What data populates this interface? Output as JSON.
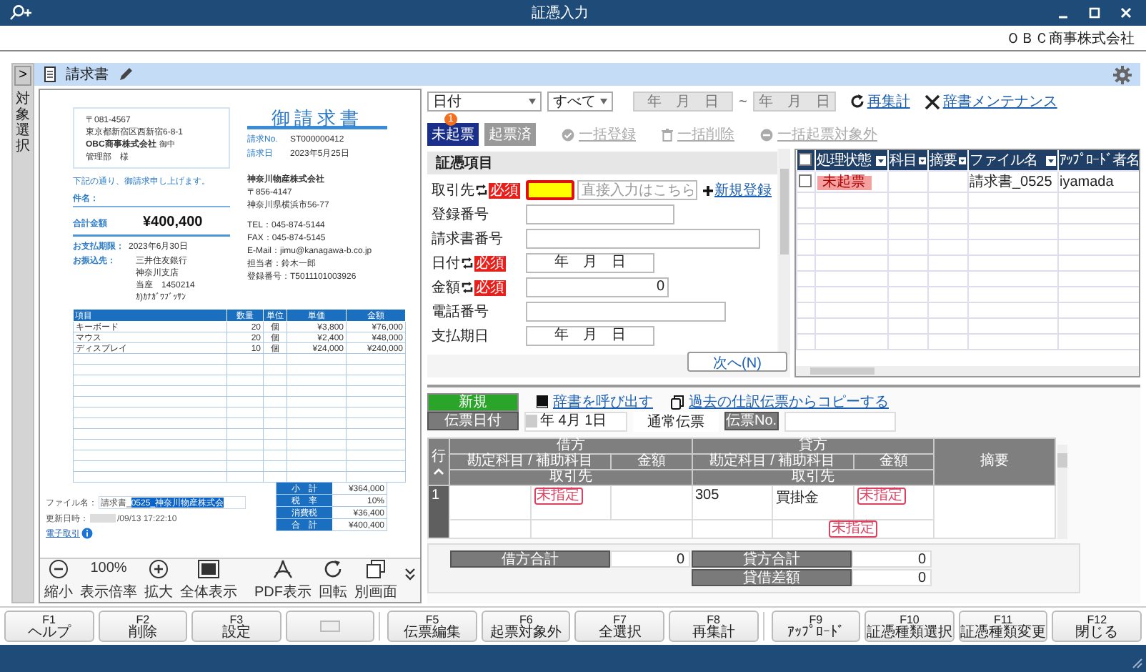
{
  "window": {
    "title": "証憑入力",
    "company": "ＯＢＣ商事株式会社"
  },
  "side_panel": {
    "expand_glyph": ">",
    "label": "対象選択"
  },
  "header": {
    "title": "請求書"
  },
  "preview": {
    "document": {
      "address": [
        "〒081-4567",
        "東京都新宿区西新宿6-8-1"
      ],
      "recipient": "OBC商事株式会社",
      "honorific": "御中",
      "department": "管理部　様",
      "title": "御請求書",
      "meta": [
        {
          "label": "請求No.",
          "value": "ST000000412"
        },
        {
          "label": "請求日",
          "value": "2023年5月25日"
        }
      ],
      "greeting": "下記の通り、御請求申し上げます。",
      "subject_label": "件名：",
      "total_label": "合計金額",
      "total": "¥400,400",
      "issuer": {
        "name": "神奈川物産株式会社",
        "lines": [
          "〒856-4147",
          "神奈川県横浜市56-77"
        ],
        "contact": [
          "TEL：045-874-5144",
          "FAX：045-874-5145",
          "E-Mail：jimu@kanagawa-b.co.jp",
          "担当者：鈴木一郎",
          "登録番号：T5011101003926"
        ]
      },
      "payment": [
        {
          "label": "お支払期限：",
          "lines": [
            "2023年6月30日"
          ]
        },
        {
          "label": "お振込先：",
          "lines": [
            "三井住友銀行",
            "神奈川支店",
            "当座　1450214",
            "ｶ)ｶﾅｶﾞﾜﾌﾞｯｻﾝ"
          ]
        }
      ],
      "table": {
        "columns": [
          "項目",
          "数量",
          "単位",
          "単価",
          "金額"
        ],
        "rows": [
          [
            "キーボード",
            "20",
            "個",
            "¥3,800",
            "¥76,000"
          ],
          [
            "マウス",
            "20",
            "個",
            "¥2,400",
            "¥48,000"
          ],
          [
            "ディスプレイ",
            "10",
            "個",
            "¥24,000",
            "¥240,000"
          ]
        ]
      },
      "totals": [
        {
          "label": "小　計",
          "value": "¥364,000"
        },
        {
          "label": "税　率",
          "value": "10%"
        },
        {
          "label": "消費税",
          "value": "¥36,400"
        },
        {
          "label": "合　計",
          "value": "¥400,400"
        }
      ]
    },
    "file_info": {
      "file_label": "ファイル名：",
      "file_value": "請求書_",
      "file_selected": "0525_神奈川物産株式会",
      "updated_label": "更新日時：",
      "updated_value": "/09/13 17:22:10",
      "link": "電子取引"
    },
    "toolbar": [
      {
        "kind": "zoom_out",
        "label": "縮小"
      },
      {
        "kind": "zoom_level",
        "value": "100%",
        "label": "表示倍率"
      },
      {
        "kind": "zoom_in",
        "label": "拡大"
      },
      {
        "kind": "fit",
        "label": "全体表示"
      },
      {
        "kind": "pdf",
        "label": "PDF表示"
      },
      {
        "kind": "rotate",
        "label": "回転"
      },
      {
        "kind": "window",
        "label": "別画面"
      }
    ]
  },
  "filters": {
    "date_type": "日付",
    "status": "すべて",
    "date_from": "年　月　日",
    "range_sep": "~",
    "date_to": "年　月　日",
    "links": [
      {
        "kind": "refresh",
        "label": "再集計"
      },
      {
        "kind": "tools",
        "label": "辞書メンテナンス"
      }
    ]
  },
  "status_tabs": [
    {
      "label": "未起票",
      "selected": true,
      "badge": "1"
    },
    {
      "label": "起票済",
      "selected": false
    }
  ],
  "bulk_actions": [
    {
      "kind": "register",
      "label": "一括登録",
      "disabled": true
    },
    {
      "kind": "delete",
      "label": "一括削除",
      "disabled": true
    },
    {
      "kind": "exclude",
      "label": "一括起票対象外",
      "disabled": true
    }
  ],
  "form": {
    "section": "証憑項目",
    "fields": [
      {
        "kind": "partner",
        "label": "取引先",
        "sync": true,
        "badge": "必須",
        "focused": true,
        "placeholder": "直接入力はこちら",
        "link": "新規登録"
      },
      {
        "kind": "text_short",
        "label": "登録番号",
        "sync": false
      },
      {
        "kind": "text_long",
        "label": "請求書番号",
        "sync": false
      },
      {
        "kind": "date",
        "label": "日付",
        "sync": true,
        "badge": "必須",
        "value": "年　月　日"
      },
      {
        "kind": "number",
        "label": "金額",
        "sync": true,
        "badge": "必須",
        "value": "0"
      },
      {
        "kind": "text_medium",
        "label": "電話番号",
        "sync": false
      },
      {
        "kind": "date",
        "label": "支払期日",
        "sync": false,
        "value": "年　月　日"
      }
    ],
    "next_button": "次へ(N)"
  },
  "documents": {
    "all_checked": false,
    "columns": [
      "処理状態",
      "科目",
      "摘要",
      "ファイル名",
      "ｱｯﾌﾟﾛｰﾄﾞ者名"
    ],
    "rows": [
      {
        "checked": false,
        "status": "未起票",
        "file": "請求書_0525",
        "uploader": "iyamada"
      }
    ]
  },
  "journal": {
    "new_label": "新規",
    "links": [
      {
        "kind": "book",
        "label": "辞書を呼び出す"
      },
      {
        "kind": "copy",
        "label": "過去の仕訳伝票からコピーする"
      }
    ],
    "date_label": "伝票日付",
    "date_value": "年  4月  1日",
    "type": "通常伝票",
    "no_label": "伝票No.",
    "row_header": "行",
    "memo_header": "摘要",
    "sides": [
      {
        "title": "借方",
        "account": "勘定科目 / 補助科目",
        "amount": "金額",
        "partner": "取引先"
      },
      {
        "title": "貸方",
        "account": "勘定科目 / 補助科目",
        "amount": "金額",
        "partner": "取引先"
      }
    ],
    "lines": [
      {
        "no": "1",
        "debit": {
          "account_tag": "未指定"
        },
        "credit": {
          "code": "305",
          "account": "買掛金",
          "amount_tag": "未指定",
          "partner_tag": "未指定"
        }
      }
    ],
    "totals": [
      {
        "label": "借方合計",
        "value": "0"
      },
      {
        "label": "貸方合計",
        "value": "0"
      },
      {
        "label": "貸借差額",
        "value": "0"
      }
    ]
  },
  "function_keys": [
    {
      "key": "F1",
      "label": "ヘルプ",
      "disabled": false
    },
    {
      "key": "F2",
      "label": "削除",
      "disabled": false
    },
    {
      "key": "F3",
      "label": "設定",
      "disabled": false
    },
    {
      "disabled": true
    },
    {
      "key": "F5",
      "label": "伝票編集",
      "disabled": false
    },
    {
      "key": "F6",
      "label": "起票対象外",
      "disabled": false
    },
    {
      "key": "F7",
      "label": "全選択",
      "disabled": false
    },
    {
      "key": "F8",
      "label": "再集計",
      "disabled": false
    },
    {
      "key": "F9",
      "label": "ｱｯﾌﾟﾛｰﾄﾞ",
      "disabled": false
    },
    {
      "key": "F10",
      "label": "証憑種類選択",
      "disabled": false
    },
    {
      "key": "F11",
      "label": "証憑種類変更",
      "disabled": false
    },
    {
      "key": "F12",
      "label": "閉じる",
      "disabled": false
    }
  ]
}
